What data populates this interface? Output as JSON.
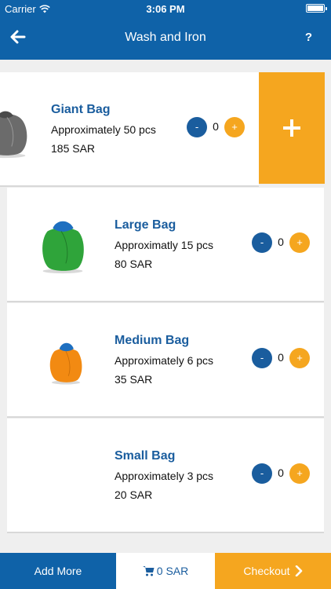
{
  "status_bar": {
    "carrier": "Carrier",
    "time": "3:06 PM"
  },
  "nav": {
    "title": "Wash and Iron",
    "help": "?"
  },
  "bags": [
    {
      "name": "Giant Bag",
      "approx": "Approximately 50 pcs",
      "price": "185 SAR",
      "qty": "0",
      "minus": "-",
      "plus": "+",
      "color": "#6b6b6b"
    },
    {
      "name": "Large Bag",
      "approx": "Approximatly 15 pcs",
      "price": "80 SAR",
      "qty": "0",
      "minus": "-",
      "plus": "+",
      "color": "#2fa43a"
    },
    {
      "name": "Medium Bag",
      "approx": "Approximately 6 pcs",
      "price": "35 SAR",
      "qty": "0",
      "minus": "-",
      "plus": "+",
      "color": "#f28a12"
    },
    {
      "name": "Small Bag",
      "approx": "Approximately 3 pcs",
      "price": "20 SAR",
      "qty": "0",
      "minus": "-",
      "plus": "+",
      "color": ""
    }
  ],
  "bottom": {
    "add_more": "Add More",
    "cart_total": "0 SAR",
    "checkout": "Checkout"
  },
  "colors": {
    "primary": "#0f62a8",
    "accent": "#f5a61f",
    "title_text": "#1a5d9e"
  }
}
